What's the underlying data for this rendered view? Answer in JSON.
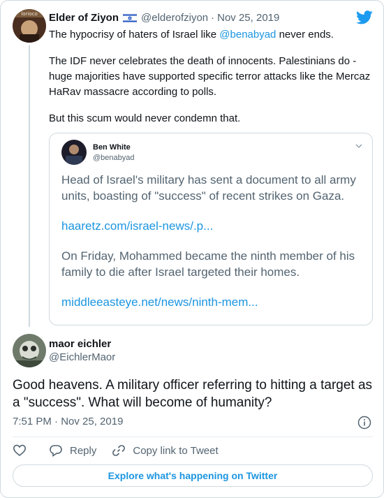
{
  "parent": {
    "name": "Elder of Ziyon",
    "handle": "@elderofziyon",
    "separator": "·",
    "date": "Nov 25, 2019",
    "avatar_text": "lorioco",
    "text_1a": "The hypocrisy of haters of Israel like ",
    "text_1_mention": "@benabyad",
    "text_1b": " never ends.",
    "text_2": "The IDF never celebrates the death of innocents. Palestinians do - huge majorities have supported specific terror attacks like the Mercaz HaRav massacre according to polls.",
    "text_3": "But this scum would never condemn that."
  },
  "quoted": {
    "name": "Ben White",
    "handle": "@benabyad",
    "text_1": "Head of Israel's military has sent a document to all army units, boasting of \"success\" of recent strikes on Gaza.",
    "link_1": "haaretz.com/israel-news/.p...",
    "text_2": "On Friday, Mohammed became the ninth member of his family to die after Israel targeted their homes.",
    "link_2": "middleeasteye.net/news/ninth-mem..."
  },
  "reply": {
    "name": "maor eichler",
    "handle": "@EichlerMaor",
    "text": "Good heavens. A military officer referring to hitting a target as a \"success\". What will become of humanity?",
    "meta": "7:51 PM · Nov 25, 2019"
  },
  "actions": {
    "reply_label": "Reply",
    "copy_label": "Copy link to Tweet"
  },
  "explore_label": "Explore what's happening on Twitter",
  "colors": {
    "link": "#1b95e0",
    "secondary_text": "#536471",
    "border": "#cfd9de",
    "twitter_blue": "#1d9bf0"
  },
  "icons": [
    "twitter-bird-icon",
    "israel-flag-icon",
    "chevron-down-icon",
    "info-icon",
    "heart-icon",
    "reply-bubble-icon",
    "link-icon"
  ]
}
